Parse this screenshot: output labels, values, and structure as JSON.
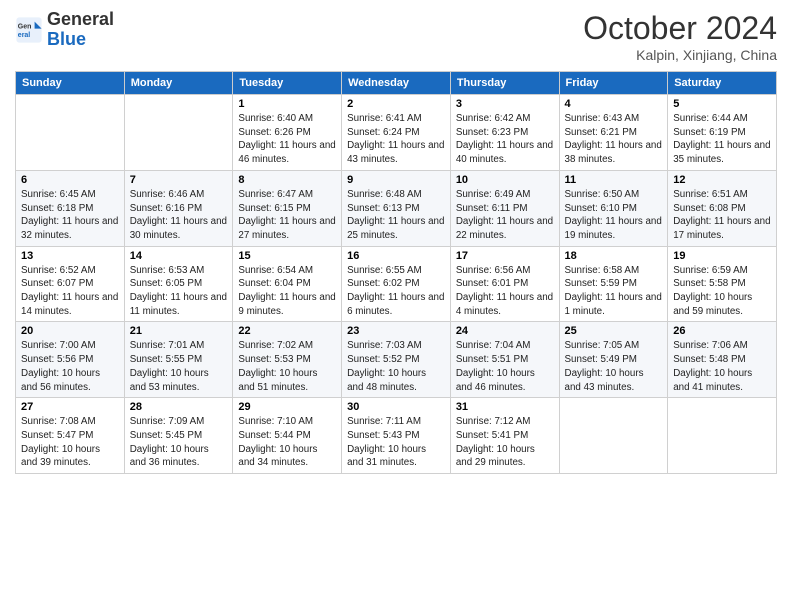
{
  "header": {
    "logo_general": "General",
    "logo_blue": "Blue",
    "title": "October 2024",
    "location": "Kalpin, Xinjiang, China"
  },
  "days_of_week": [
    "Sunday",
    "Monday",
    "Tuesday",
    "Wednesday",
    "Thursday",
    "Friday",
    "Saturday"
  ],
  "weeks": [
    [
      {
        "day": "",
        "sunrise": "",
        "sunset": "",
        "daylight": ""
      },
      {
        "day": "",
        "sunrise": "",
        "sunset": "",
        "daylight": ""
      },
      {
        "day": "1",
        "sunrise": "Sunrise: 6:40 AM",
        "sunset": "Sunset: 6:26 PM",
        "daylight": "Daylight: 11 hours and 46 minutes."
      },
      {
        "day": "2",
        "sunrise": "Sunrise: 6:41 AM",
        "sunset": "Sunset: 6:24 PM",
        "daylight": "Daylight: 11 hours and 43 minutes."
      },
      {
        "day": "3",
        "sunrise": "Sunrise: 6:42 AM",
        "sunset": "Sunset: 6:23 PM",
        "daylight": "Daylight: 11 hours and 40 minutes."
      },
      {
        "day": "4",
        "sunrise": "Sunrise: 6:43 AM",
        "sunset": "Sunset: 6:21 PM",
        "daylight": "Daylight: 11 hours and 38 minutes."
      },
      {
        "day": "5",
        "sunrise": "Sunrise: 6:44 AM",
        "sunset": "Sunset: 6:19 PM",
        "daylight": "Daylight: 11 hours and 35 minutes."
      }
    ],
    [
      {
        "day": "6",
        "sunrise": "Sunrise: 6:45 AM",
        "sunset": "Sunset: 6:18 PM",
        "daylight": "Daylight: 11 hours and 32 minutes."
      },
      {
        "day": "7",
        "sunrise": "Sunrise: 6:46 AM",
        "sunset": "Sunset: 6:16 PM",
        "daylight": "Daylight: 11 hours and 30 minutes."
      },
      {
        "day": "8",
        "sunrise": "Sunrise: 6:47 AM",
        "sunset": "Sunset: 6:15 PM",
        "daylight": "Daylight: 11 hours and 27 minutes."
      },
      {
        "day": "9",
        "sunrise": "Sunrise: 6:48 AM",
        "sunset": "Sunset: 6:13 PM",
        "daylight": "Daylight: 11 hours and 25 minutes."
      },
      {
        "day": "10",
        "sunrise": "Sunrise: 6:49 AM",
        "sunset": "Sunset: 6:11 PM",
        "daylight": "Daylight: 11 hours and 22 minutes."
      },
      {
        "day": "11",
        "sunrise": "Sunrise: 6:50 AM",
        "sunset": "Sunset: 6:10 PM",
        "daylight": "Daylight: 11 hours and 19 minutes."
      },
      {
        "day": "12",
        "sunrise": "Sunrise: 6:51 AM",
        "sunset": "Sunset: 6:08 PM",
        "daylight": "Daylight: 11 hours and 17 minutes."
      }
    ],
    [
      {
        "day": "13",
        "sunrise": "Sunrise: 6:52 AM",
        "sunset": "Sunset: 6:07 PM",
        "daylight": "Daylight: 11 hours and 14 minutes."
      },
      {
        "day": "14",
        "sunrise": "Sunrise: 6:53 AM",
        "sunset": "Sunset: 6:05 PM",
        "daylight": "Daylight: 11 hours and 11 minutes."
      },
      {
        "day": "15",
        "sunrise": "Sunrise: 6:54 AM",
        "sunset": "Sunset: 6:04 PM",
        "daylight": "Daylight: 11 hours and 9 minutes."
      },
      {
        "day": "16",
        "sunrise": "Sunrise: 6:55 AM",
        "sunset": "Sunset: 6:02 PM",
        "daylight": "Daylight: 11 hours and 6 minutes."
      },
      {
        "day": "17",
        "sunrise": "Sunrise: 6:56 AM",
        "sunset": "Sunset: 6:01 PM",
        "daylight": "Daylight: 11 hours and 4 minutes."
      },
      {
        "day": "18",
        "sunrise": "Sunrise: 6:58 AM",
        "sunset": "Sunset: 5:59 PM",
        "daylight": "Daylight: 11 hours and 1 minute."
      },
      {
        "day": "19",
        "sunrise": "Sunrise: 6:59 AM",
        "sunset": "Sunset: 5:58 PM",
        "daylight": "Daylight: 10 hours and 59 minutes."
      }
    ],
    [
      {
        "day": "20",
        "sunrise": "Sunrise: 7:00 AM",
        "sunset": "Sunset: 5:56 PM",
        "daylight": "Daylight: 10 hours and 56 minutes."
      },
      {
        "day": "21",
        "sunrise": "Sunrise: 7:01 AM",
        "sunset": "Sunset: 5:55 PM",
        "daylight": "Daylight: 10 hours and 53 minutes."
      },
      {
        "day": "22",
        "sunrise": "Sunrise: 7:02 AM",
        "sunset": "Sunset: 5:53 PM",
        "daylight": "Daylight: 10 hours and 51 minutes."
      },
      {
        "day": "23",
        "sunrise": "Sunrise: 7:03 AM",
        "sunset": "Sunset: 5:52 PM",
        "daylight": "Daylight: 10 hours and 48 minutes."
      },
      {
        "day": "24",
        "sunrise": "Sunrise: 7:04 AM",
        "sunset": "Sunset: 5:51 PM",
        "daylight": "Daylight: 10 hours and 46 minutes."
      },
      {
        "day": "25",
        "sunrise": "Sunrise: 7:05 AM",
        "sunset": "Sunset: 5:49 PM",
        "daylight": "Daylight: 10 hours and 43 minutes."
      },
      {
        "day": "26",
        "sunrise": "Sunrise: 7:06 AM",
        "sunset": "Sunset: 5:48 PM",
        "daylight": "Daylight: 10 hours and 41 minutes."
      }
    ],
    [
      {
        "day": "27",
        "sunrise": "Sunrise: 7:08 AM",
        "sunset": "Sunset: 5:47 PM",
        "daylight": "Daylight: 10 hours and 39 minutes."
      },
      {
        "day": "28",
        "sunrise": "Sunrise: 7:09 AM",
        "sunset": "Sunset: 5:45 PM",
        "daylight": "Daylight: 10 hours and 36 minutes."
      },
      {
        "day": "29",
        "sunrise": "Sunrise: 7:10 AM",
        "sunset": "Sunset: 5:44 PM",
        "daylight": "Daylight: 10 hours and 34 minutes."
      },
      {
        "day": "30",
        "sunrise": "Sunrise: 7:11 AM",
        "sunset": "Sunset: 5:43 PM",
        "daylight": "Daylight: 10 hours and 31 minutes."
      },
      {
        "day": "31",
        "sunrise": "Sunrise: 7:12 AM",
        "sunset": "Sunset: 5:41 PM",
        "daylight": "Daylight: 10 hours and 29 minutes."
      },
      {
        "day": "",
        "sunrise": "",
        "sunset": "",
        "daylight": ""
      },
      {
        "day": "",
        "sunrise": "",
        "sunset": "",
        "daylight": ""
      }
    ]
  ]
}
